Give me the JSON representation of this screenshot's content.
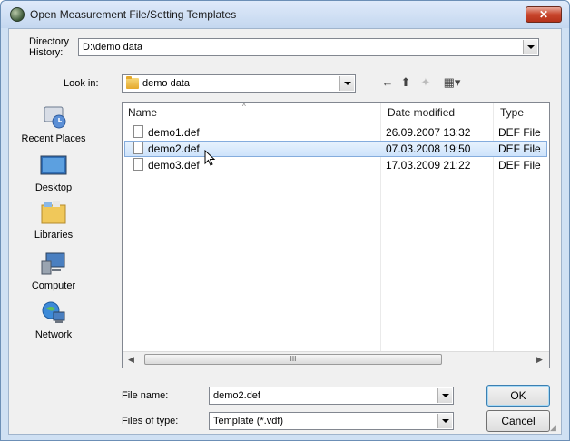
{
  "window": {
    "title": "Open Measurement File/Setting Templates",
    "close_glyph": "✕"
  },
  "directory_history": {
    "label": "Directory History:",
    "value": "D:\\demo data"
  },
  "look_in": {
    "label": "Look in:",
    "value": "demo data"
  },
  "places": [
    {
      "label": "Recent Places",
      "icon": "recent-places-icon"
    },
    {
      "label": "Desktop",
      "icon": "desktop-icon"
    },
    {
      "label": "Libraries",
      "icon": "libraries-icon"
    },
    {
      "label": "Computer",
      "icon": "computer-icon"
    },
    {
      "label": "Network",
      "icon": "network-icon"
    }
  ],
  "columns": {
    "name": "Name",
    "date": "Date modified",
    "type": "Type"
  },
  "files": [
    {
      "name": "demo1.def",
      "date": "26.09.2007 13:32",
      "type": "DEF File",
      "selected": false
    },
    {
      "name": "demo2.def",
      "date": "07.03.2008 19:50",
      "type": "DEF File",
      "selected": true
    },
    {
      "name": "demo3.def",
      "date": "17.03.2009 21:22",
      "type": "DEF File",
      "selected": false
    }
  ],
  "scroll_thumb_glyph": "III",
  "file_name": {
    "label": "File name:",
    "value": "demo2.def"
  },
  "files_of_type": {
    "label": "Files of type:",
    "value": "Template (*.vdf)"
  },
  "buttons": {
    "ok": "OK",
    "cancel": "Cancel"
  },
  "colors": {
    "selection": "#cde3fb",
    "selection_border": "#84acdd",
    "close": "#c8452c"
  }
}
